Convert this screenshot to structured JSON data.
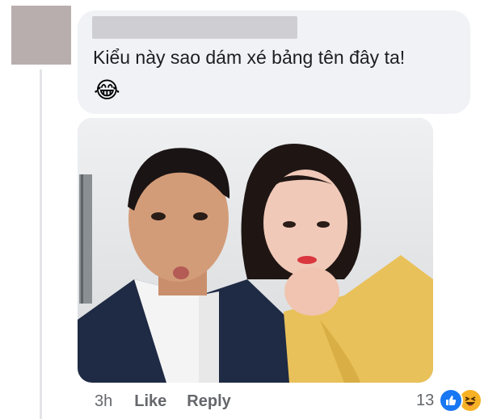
{
  "comment": {
    "text": "Kiểu này sao dám xé bảng tên đây ta!",
    "emoji": "😂",
    "emoji_name": "face-with-tears-of-joy"
  },
  "photo": {
    "subject": "selfie-of-two-people"
  },
  "actions": {
    "time": "3h",
    "like_label": "Like",
    "reply_label": "Reply"
  },
  "reactions": {
    "count": "13",
    "icons": [
      "like-icon",
      "haha-icon"
    ]
  },
  "colors": {
    "bubble": "#f0f2f5",
    "like_blue": "#1877f2",
    "haha_yellow": "#f7b125",
    "meta_gray": "#65676b"
  }
}
